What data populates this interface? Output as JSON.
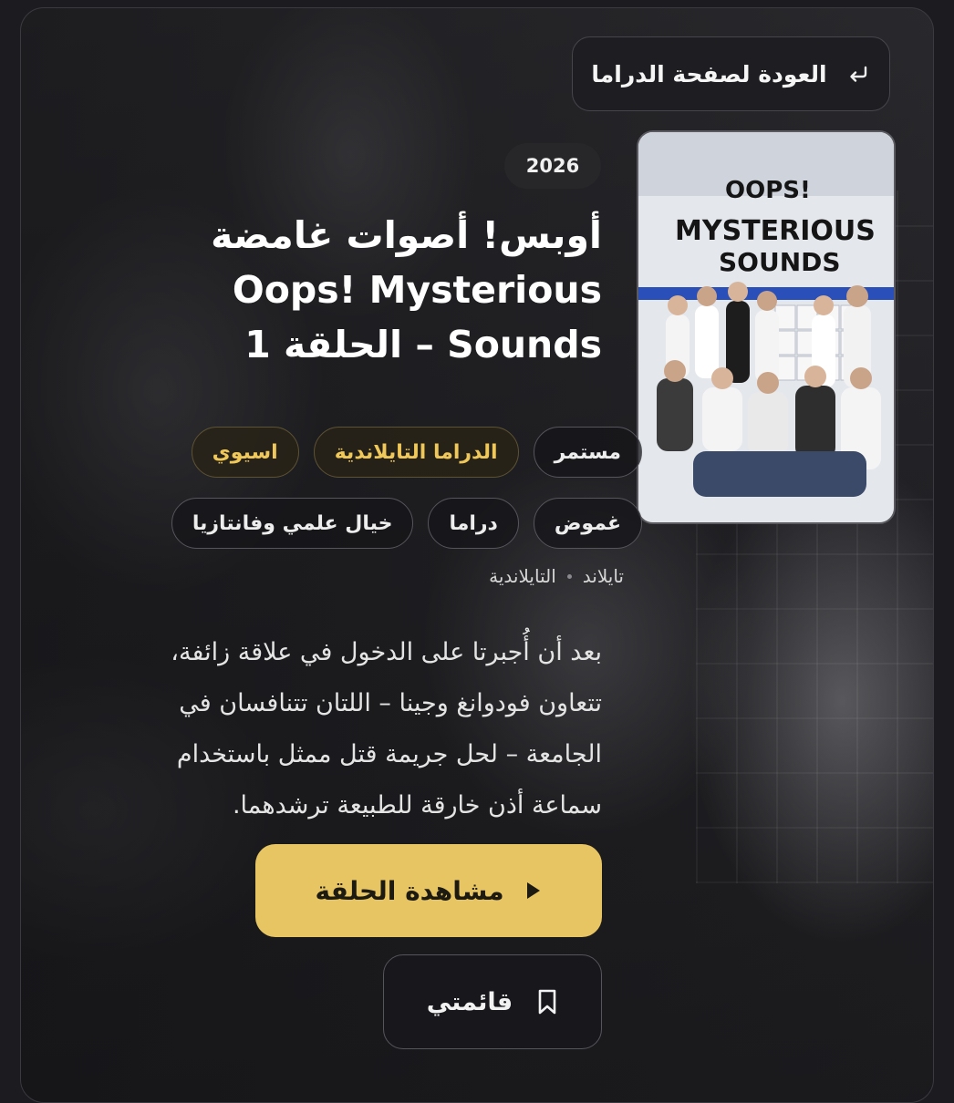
{
  "back_button": {
    "label": "العودة لصفحة الدراما",
    "icon": "return-arrow-icon"
  },
  "poster": {
    "line1": "OOPS!",
    "line2": "MYSTERIOUS",
    "line3": "SOUNDS"
  },
  "year": "2026",
  "title": {
    "line1": "أوبس! أصوات غامضة",
    "line2": "Oops! Mysterious",
    "line3": "Sounds – الحلقة 1"
  },
  "tags_row1": [
    "اسيوي",
    "الدراما التايلاندية",
    "مستمر"
  ],
  "tags_row2": [
    "خيال علمي وفانتازيا",
    "دراما",
    "غموض"
  ],
  "meta": {
    "country": "تايلاند",
    "language": "التايلاندية"
  },
  "description": {
    "line1": "بعد أن أُجبرتا على الدخول في علاقة زائفة،",
    "line2": "تتعاون فودوانغ وجينا – اللتان تتنافسان في",
    "line3": "الجامعة – لحل جريمة قتل ممثل باستخدام",
    "line4": "سماعة أذن خارقة للطبيعة ترشدهما."
  },
  "watch_button": {
    "label": "مشاهدة الحلقة",
    "icon": "play-icon"
  },
  "list_button": {
    "label": "قائمتي",
    "icon": "bookmark-icon"
  },
  "colors": {
    "accent": "#e8c563",
    "tag_gold": "#f0c85a",
    "background": "#1c1c20"
  }
}
